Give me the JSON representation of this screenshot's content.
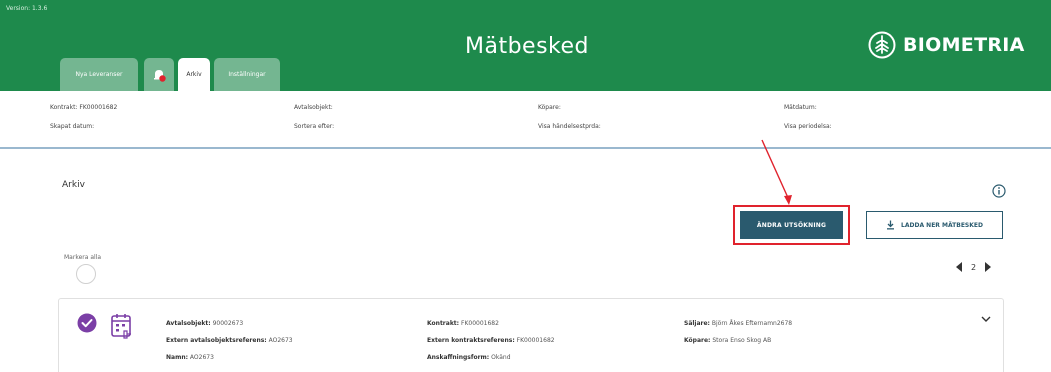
{
  "app": {
    "version": "Version: 1.3.6",
    "title": "Mätbesked",
    "brand": "BIOMETRIA",
    "colors": {
      "header_green": "#1e8a4c",
      "primary_button": "#2a5a6e",
      "accent_purple": "#7b3fa6",
      "highlight_red": "#e0232d"
    }
  },
  "tabs": [
    {
      "label": "Nya Leveranser",
      "active": false
    },
    {
      "label": "",
      "icon": "notification-bell-icon",
      "active": false
    },
    {
      "label": "Arkiv",
      "active": true
    },
    {
      "label": "Inställningar",
      "active": false
    }
  ],
  "info": {
    "kontrakt": "Kontrakt: FK00001682",
    "avtalsobjekt": "Avtalsobjekt:",
    "kopare": "Köpare:",
    "matdatum": "Mätdatum:",
    "skapat_datum": "Skapat datum:",
    "sortera_efter": "Sortera efter:",
    "visa_handelsepr": "Visa händelsestprda:",
    "visa_periodelsa": "Visa periodelsa:"
  },
  "archive": {
    "title": "Arkiv",
    "info_icon": "info-circle-icon",
    "andra_button": "ÄNDRA UTSÖKNING",
    "ladda_button": "LADDA NER MÄTBESKED",
    "mark_all_label": "Markera alla",
    "page": "2"
  },
  "card": {
    "avtalsobjekt": {
      "key": "Avtalsobjekt:",
      "value": "90002673"
    },
    "extern_avtalsobjektsreferens": {
      "key": "Extern avtalsobjektsreferens:",
      "value": "AO2673"
    },
    "namn": {
      "key": "Namn:",
      "value": "AO2673"
    },
    "kontrakt": {
      "key": "Kontrakt:",
      "value": "FK00001682"
    },
    "extern_kontraktsreferens": {
      "key": "Extern kontraktsreferens:",
      "value": "FK00001682"
    },
    "anskaffningsform": {
      "key": "Anskaffningsform:",
      "value": "Okänd"
    },
    "saljare": {
      "key": "Säljare:",
      "value": "Björn Åkes Efternamn2678"
    },
    "kopare": {
      "key": "Köpare:",
      "value": "Stora Enso Skog AB"
    }
  }
}
